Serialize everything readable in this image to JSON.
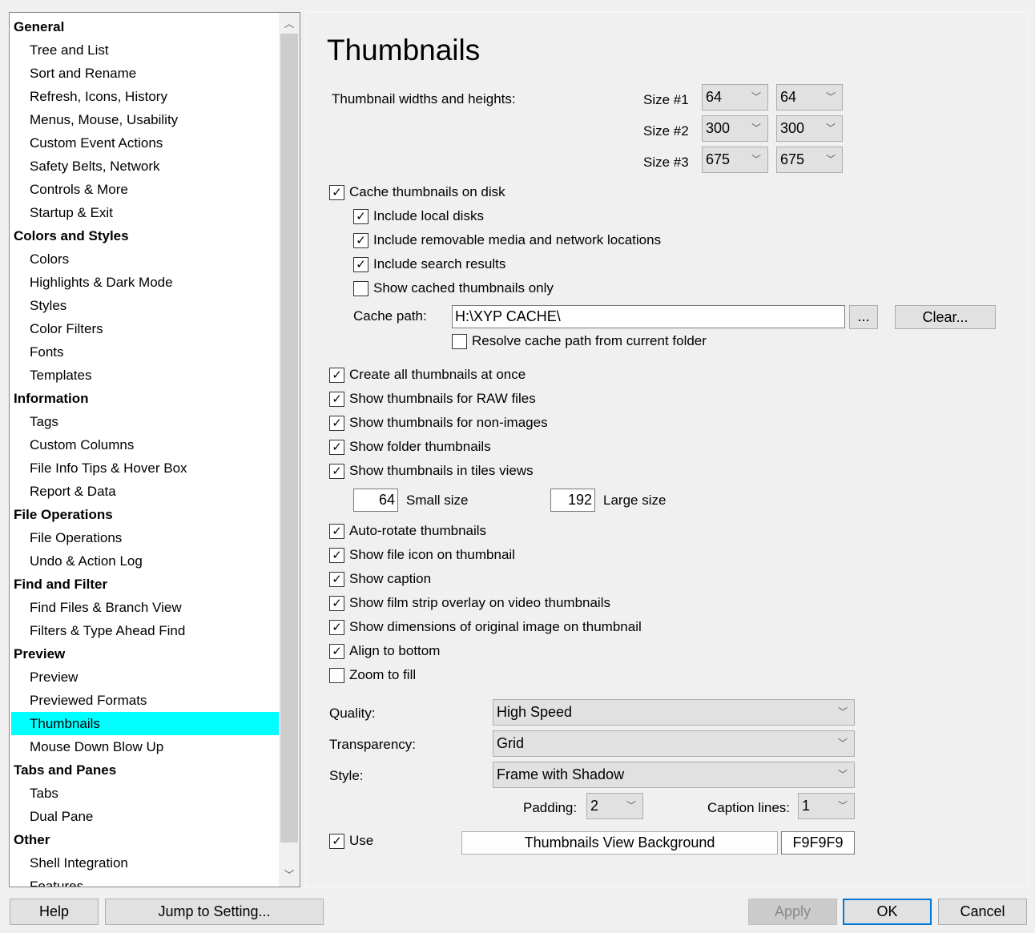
{
  "tree": {
    "items": [
      {
        "label": "General",
        "type": "header"
      },
      {
        "label": "Tree and List",
        "type": "child"
      },
      {
        "label": "Sort and Rename",
        "type": "child"
      },
      {
        "label": "Refresh, Icons, History",
        "type": "child"
      },
      {
        "label": "Menus, Mouse, Usability",
        "type": "child"
      },
      {
        "label": "Custom Event Actions",
        "type": "child"
      },
      {
        "label": "Safety Belts, Network",
        "type": "child"
      },
      {
        "label": "Controls & More",
        "type": "child"
      },
      {
        "label": "Startup & Exit",
        "type": "child"
      },
      {
        "label": "Colors and Styles",
        "type": "header"
      },
      {
        "label": "Colors",
        "type": "child"
      },
      {
        "label": "Highlights & Dark Mode",
        "type": "child"
      },
      {
        "label": "Styles",
        "type": "child"
      },
      {
        "label": "Color Filters",
        "type": "child"
      },
      {
        "label": "Fonts",
        "type": "child"
      },
      {
        "label": "Templates",
        "type": "child"
      },
      {
        "label": "Information",
        "type": "header"
      },
      {
        "label": "Tags",
        "type": "child"
      },
      {
        "label": "Custom Columns",
        "type": "child"
      },
      {
        "label": "File Info Tips & Hover Box",
        "type": "child"
      },
      {
        "label": "Report & Data",
        "type": "child"
      },
      {
        "label": "File Operations",
        "type": "header"
      },
      {
        "label": "File Operations",
        "type": "child"
      },
      {
        "label": "Undo & Action Log",
        "type": "child"
      },
      {
        "label": "Find and Filter",
        "type": "header"
      },
      {
        "label": "Find Files & Branch View",
        "type": "child"
      },
      {
        "label": "Filters & Type Ahead Find",
        "type": "child"
      },
      {
        "label": "Preview",
        "type": "header"
      },
      {
        "label": "Preview",
        "type": "child"
      },
      {
        "label": "Previewed Formats",
        "type": "child"
      },
      {
        "label": "Thumbnails",
        "type": "child",
        "selected": true
      },
      {
        "label": "Mouse Down Blow Up",
        "type": "child"
      },
      {
        "label": "Tabs and Panes",
        "type": "header"
      },
      {
        "label": "Tabs",
        "type": "child"
      },
      {
        "label": "Dual Pane",
        "type": "child"
      },
      {
        "label": "Other",
        "type": "header"
      },
      {
        "label": "Shell Integration",
        "type": "child"
      },
      {
        "label": "Features",
        "type": "child"
      }
    ],
    "selected_color": "#00FFFF"
  },
  "page": {
    "title": "Thumbnails",
    "sizes_label": "Thumbnail widths and heights:",
    "sizes": [
      {
        "label": "Size #1",
        "w": "64",
        "h": "64"
      },
      {
        "label": "Size #2",
        "w": "300",
        "h": "300"
      },
      {
        "label": "Size #3",
        "w": "675",
        "h": "675"
      }
    ]
  },
  "checks": [
    {
      "label": "Cache thumbnails on disk",
      "checked": true
    },
    {
      "label": "Include local disks",
      "checked": true
    },
    {
      "label": "Include removable media and network locations",
      "checked": true
    },
    {
      "label": "Include search results",
      "checked": true
    },
    {
      "label": "Show cached thumbnails only",
      "checked": false
    },
    {
      "label": "Resolve cache path from current folder",
      "checked": false
    },
    {
      "label": "Create all thumbnails at once",
      "checked": true
    },
    {
      "label": "Show thumbnails for RAW files",
      "checked": true
    },
    {
      "label": "Show thumbnails for non-images",
      "checked": true
    },
    {
      "label": "Show folder thumbnails",
      "checked": true
    },
    {
      "label": "Show thumbnails in tiles views",
      "checked": true
    },
    {
      "label": "Auto-rotate thumbnails",
      "checked": true
    },
    {
      "label": "Show file icon on thumbnail",
      "checked": true
    },
    {
      "label": "Show caption",
      "checked": true
    },
    {
      "label": "Show film strip overlay on video thumbnails",
      "checked": true
    },
    {
      "label": "Show dimensions of original image on thumbnail",
      "checked": true
    },
    {
      "label": "Align to bottom",
      "checked": true
    },
    {
      "label": "Zoom to fill",
      "checked": false
    },
    {
      "label": "Use",
      "checked": true
    }
  ],
  "cache": {
    "label": "Cache path:",
    "value": "H:\\XYP CACHE\\",
    "browse": "...",
    "clear": "Clear..."
  },
  "tiles": {
    "small_value": "64",
    "small_label": "Small size",
    "large_value": "192",
    "large_label": "Large size"
  },
  "quality": {
    "label": "Quality:",
    "value": "High Speed"
  },
  "transparency": {
    "label": "Transparency:",
    "value": "Grid"
  },
  "style": {
    "label": "Style:",
    "value": "Frame with Shadow"
  },
  "padding": {
    "label": "Padding:",
    "value": "2"
  },
  "caption_lines": {
    "label": "Caption lines:",
    "value": "1"
  },
  "background": {
    "button": "Thumbnails View Background",
    "value": "F9F9F9"
  },
  "footer": {
    "help": "Help",
    "jump": "Jump to Setting...",
    "apply": "Apply",
    "ok": "OK",
    "cancel": "Cancel"
  }
}
